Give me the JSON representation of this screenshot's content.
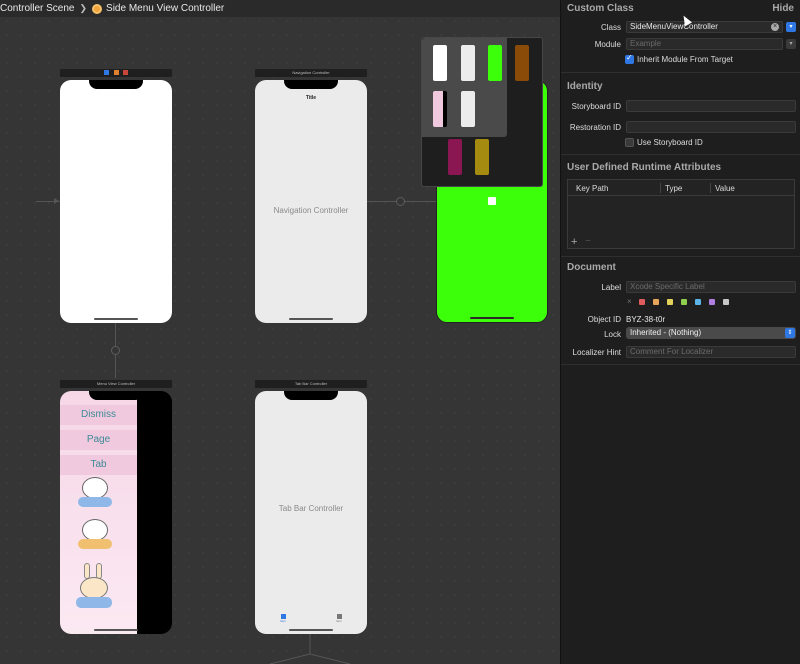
{
  "jumpbar": {
    "controller_scene": "Controller Scene",
    "current": "Side Menu View Controller"
  },
  "scenes": {
    "root_bar_icons": [
      "blue",
      "orange",
      "red"
    ],
    "navigation_controller": {
      "bar_title": "Navigation Controller",
      "nav_title": "Title",
      "label": "Navigation Controller"
    },
    "menu_view_controller": {
      "bar_title": "Menu View Controller",
      "buttons": [
        "Dismiss",
        "Page",
        "Tab"
      ]
    },
    "tab_bar_controller": {
      "bar_title": "Tab Bar Controller",
      "label": "Tab Bar Controller",
      "tab_items": [
        "Item",
        "Item"
      ]
    }
  },
  "inspector": {
    "custom_class": {
      "title": "Custom Class",
      "hide": "Hide",
      "class_label": "Class",
      "class_value": "SideMenuViewController",
      "module_label": "Module",
      "module_placeholder": "Example",
      "inherit_label": "Inherit Module From Target",
      "inherit_checked": true
    },
    "identity": {
      "title": "Identity",
      "storyboard_id_label": "Storyboard ID",
      "storyboard_id_value": "",
      "restoration_id_label": "Restoration ID",
      "restoration_id_value": "",
      "use_storyboard_id_label": "Use Storyboard ID",
      "use_storyboard_id_checked": false
    },
    "runtime_attributes": {
      "title": "User Defined Runtime Attributes",
      "columns": [
        "Key Path",
        "Type",
        "Value"
      ],
      "add": "+",
      "remove": "−"
    },
    "document": {
      "title": "Document",
      "label_label": "Label",
      "label_placeholder": "Xcode Specific Label",
      "color_clear": "×",
      "colors": [
        "#e05c5c",
        "#e8a45a",
        "#e3d35a",
        "#8fd14f",
        "#5ab4e8",
        "#b07ee0",
        "#c8c8c8"
      ],
      "object_id_label": "Object ID",
      "object_id_value": "BYZ-38-t0r",
      "lock_label": "Lock",
      "lock_value": "Inherited - (Nothing)",
      "localizer_label": "Localizer Hint",
      "localizer_placeholder": "Comment For Localizer"
    }
  }
}
